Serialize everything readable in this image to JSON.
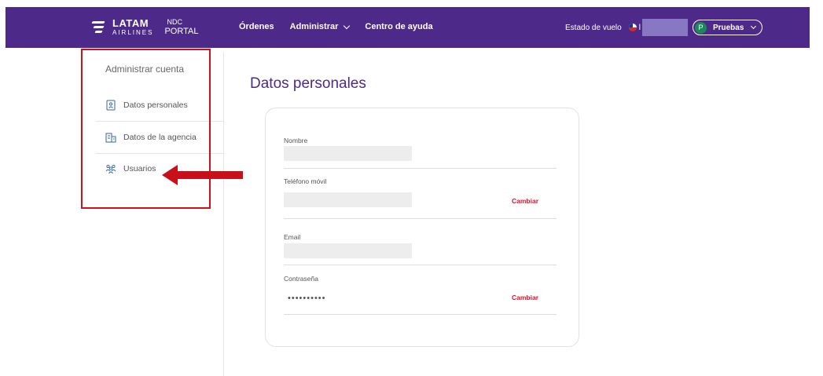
{
  "header": {
    "brand_name": "LATAM",
    "brand_sub": "AIRLINES",
    "portal_top": "NDC",
    "portal_bottom": "PORTAL",
    "nav": [
      {
        "label": "Órdenes"
      },
      {
        "label": "Administrar"
      },
      {
        "label": "Centro de ayuda"
      }
    ],
    "flight_status": "Estado de vuelo",
    "language": "l",
    "profile_initial": "P",
    "profile_name": "Pruebas",
    "bar_color": "#4d2a8a"
  },
  "sidebar": {
    "title": "Administrar cuenta",
    "items": [
      {
        "label": "Datos personales",
        "icon": "user-badge-icon"
      },
      {
        "label": "Datos de la agencia",
        "icon": "building-icon"
      },
      {
        "label": "Usuarios",
        "icon": "users-icon"
      }
    ]
  },
  "main": {
    "title": "Datos personales",
    "fields": [
      {
        "label": "Nombre",
        "value": ""
      },
      {
        "label": "Teléfono móvil",
        "value": "",
        "action": "Cambiar"
      },
      {
        "label": "Email",
        "value": ""
      },
      {
        "label": "Contraseña",
        "value": "••••••••••",
        "action": "Cambiar"
      }
    ]
  },
  "annotation": {
    "highlight_color": "#d0111b"
  }
}
